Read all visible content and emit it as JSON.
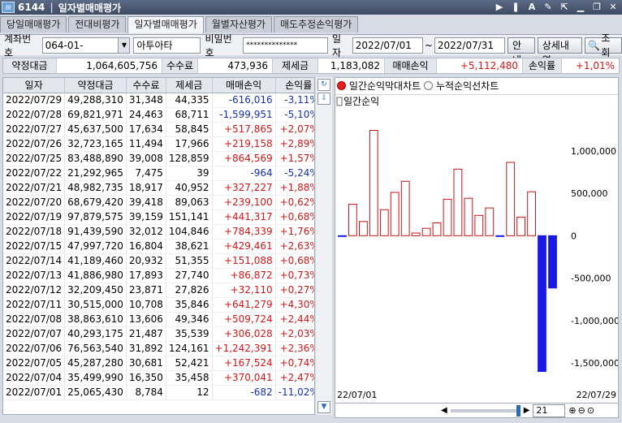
{
  "window": {
    "icon": "app-icon",
    "code": "6144",
    "title": "일자별매매평가"
  },
  "tabs": [
    "당일매매평가",
    "전대비평가",
    "일자별매매평가",
    "월별자산평가",
    "매도추정손익평가"
  ],
  "active_tab": 2,
  "filter": {
    "account_label": "계좌번호",
    "account_value": "064-01-",
    "account_name": "아투아타",
    "password_label": "비밀번호",
    "password_value": "**************",
    "date_label": "일자",
    "date_from": "2022/07/01",
    "date_sep": "~",
    "date_to": "2022/07/31",
    "guide_button": "안내",
    "detail_button": "상세내역",
    "query_button": "조회"
  },
  "summary": {
    "amount_label": "약정대금",
    "amount_value": "1,064,605,756",
    "fee_label": "수수료",
    "fee_value": "473,936",
    "tax_label": "제세금",
    "tax_value": "1,183,082",
    "pnl_label": "매매손익",
    "pnl_value": "+5,112,480",
    "rate_label": "손익률",
    "rate_value": "+1,01%"
  },
  "table": {
    "columns": [
      "일자",
      "약정대금",
      "수수료",
      "제세금",
      "매매손익",
      "손익률"
    ],
    "rows": [
      [
        "2022/07/29",
        "49,288,310",
        "31,348",
        "44,335",
        "-616,016",
        "-3,11%"
      ],
      [
        "2022/07/28",
        "69,821,971",
        "24,463",
        "68,711",
        "-1,599,951",
        "-5,10%"
      ],
      [
        "2022/07/27",
        "45,637,500",
        "17,634",
        "58,845",
        "+517,865",
        "+2,07%"
      ],
      [
        "2022/07/26",
        "32,723,165",
        "11,494",
        "17,966",
        "+219,158",
        "+2,89%"
      ],
      [
        "2022/07/25",
        "83,488,890",
        "39,008",
        "128,859",
        "+864,569",
        "+1,57%"
      ],
      [
        "2022/07/22",
        "21,292,965",
        "7,475",
        "39",
        "-964",
        "-5,24%"
      ],
      [
        "2022/07/21",
        "48,982,735",
        "18,917",
        "40,952",
        "+327,227",
        "+1,88%"
      ],
      [
        "2022/07/20",
        "68,679,420",
        "39,418",
        "89,063",
        "+239,100",
        "+0,62%"
      ],
      [
        "2022/07/19",
        "97,879,575",
        "39,159",
        "151,141",
        "+441,317",
        "+0,68%"
      ],
      [
        "2022/07/18",
        "91,439,590",
        "32,012",
        "104,846",
        "+784,339",
        "+1,76%"
      ],
      [
        "2022/07/15",
        "47,997,720",
        "16,804",
        "38,621",
        "+429,461",
        "+2,63%"
      ],
      [
        "2022/07/14",
        "41,189,460",
        "20,932",
        "51,355",
        "+151,088",
        "+0,68%"
      ],
      [
        "2022/07/13",
        "41,886,980",
        "17,893",
        "27,740",
        "+86,872",
        "+0,73%"
      ],
      [
        "2022/07/12",
        "32,209,450",
        "23,871",
        "27,826",
        "+32,110",
        "+0,27%"
      ],
      [
        "2022/07/11",
        "30,515,000",
        "10,708",
        "35,846",
        "+641,279",
        "+4,30%"
      ],
      [
        "2022/07/08",
        "38,863,610",
        "13,606",
        "49,346",
        "+509,724",
        "+2,44%"
      ],
      [
        "2022/07/07",
        "40,293,175",
        "21,487",
        "35,539",
        "+306,028",
        "+2,03%"
      ],
      [
        "2022/07/06",
        "76,563,540",
        "31,892",
        "124,161",
        "+1,242,391",
        "+2,36%"
      ],
      [
        "2022/07/05",
        "45,287,280",
        "30,681",
        "52,421",
        "+167,524",
        "+0,74%"
      ],
      [
        "2022/07/04",
        "35,499,990",
        "16,350",
        "35,458",
        "+370,041",
        "+2,47%"
      ],
      [
        "2022/07/01",
        "25,065,430",
        "8,784",
        "12",
        "-682",
        "-11,02%"
      ]
    ]
  },
  "chart_panel": {
    "radio_daily": "일간순익막대차트",
    "radio_cumulative": "누적순익선차트",
    "legend": "일간순익",
    "x_start": "22/07/01",
    "x_end": "22/07/29",
    "zoom_value": "21"
  },
  "chart_data": {
    "type": "bar",
    "categories": [
      "07/01",
      "07/04",
      "07/05",
      "07/06",
      "07/07",
      "07/08",
      "07/11",
      "07/12",
      "07/13",
      "07/14",
      "07/15",
      "07/18",
      "07/19",
      "07/20",
      "07/21",
      "07/22",
      "07/25",
      "07/26",
      "07/27",
      "07/28",
      "07/29"
    ],
    "values": [
      -682,
      370041,
      167524,
      1242391,
      306028,
      509724,
      641279,
      32110,
      86872,
      151088,
      429461,
      784339,
      441317,
      239100,
      327227,
      -964,
      864569,
      219158,
      517865,
      -1599951,
      -616016
    ],
    "ylim": [
      -1700000,
      1400000
    ],
    "yticks": [
      1000000,
      500000,
      0,
      -500000,
      -1000000,
      -1500000
    ],
    "ytick_labels": [
      "1,000,000",
      "500,000",
      "0",
      "-500,000",
      "-1,000,000",
      "-1,500,000"
    ],
    "colors": {
      "positive": "#c81414",
      "negative": "#1a1ae6"
    }
  }
}
